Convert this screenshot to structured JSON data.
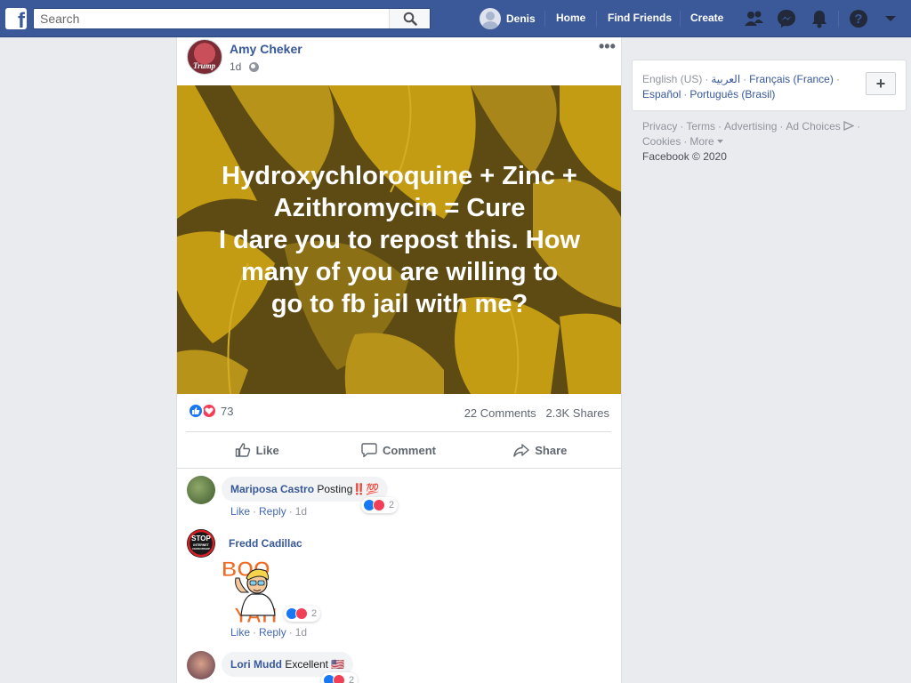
{
  "topbar": {
    "search_placeholder": "Search",
    "user_name": "Denis",
    "home": "Home",
    "find_friends": "Find Friends",
    "create": "Create"
  },
  "post": {
    "author": "Amy Cheker",
    "time": "1d",
    "avatar_text": "Trump",
    "image_text": "Hydroxychloroquine + Zinc + Azithromycin = Cure\nI dare you to repost this. How many of you are willing to go to fb jail with me?",
    "reaction_count": "73",
    "comments_count": "22 Comments",
    "shares_count": "2.3K Shares",
    "actions": {
      "like": "Like",
      "comment": "Comment",
      "share": "Share"
    },
    "colors": {
      "image_bg_dark": "#5e4b14",
      "image_bg_gold": "#c39c14"
    }
  },
  "comments": [
    {
      "name": "Mariposa Castro",
      "text": "Posting",
      "emoji": "‼️💯",
      "reactions": "2",
      "like": "Like",
      "reply": "Reply",
      "time": "1d"
    },
    {
      "name": "Fredd Cadillac",
      "avatar_text": "STOP INTERNET CENSORSHIP",
      "sticker_top": "BOO",
      "sticker_bottom": "YAH",
      "reactions": "2",
      "like": "Like",
      "reply": "Reply",
      "time": "1d"
    },
    {
      "name": "Lori Mudd",
      "text": "Excellent",
      "emoji": "🇺🇸",
      "reactions": "2"
    }
  ],
  "sidebar": {
    "languages": {
      "current": "English (US)",
      "arabic": "العربية",
      "french": "Français (France)",
      "spanish": "Español",
      "portuguese": "Português (Brasil)"
    },
    "add_language": "+",
    "footer": {
      "privacy": "Privacy",
      "terms": "Terms",
      "advertising": "Advertising",
      "ad_choices": "Ad Choices",
      "cookies": "Cookies",
      "more": "More",
      "copyright": "Facebook © 2020"
    }
  }
}
